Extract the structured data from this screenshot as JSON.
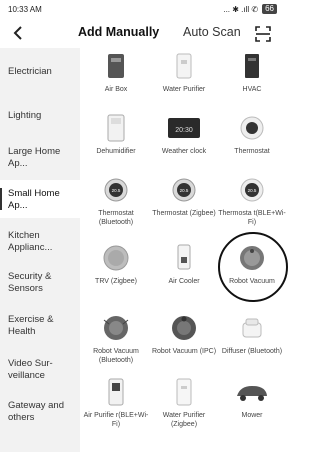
{
  "status": {
    "time": "10:33 AM",
    "icons": "... ✱ .ıll ✆",
    "battery": "66"
  },
  "header": {
    "back_glyph": "<",
    "tab_manual": "Add Manually",
    "tab_auto": "Auto Scan"
  },
  "sidebar": {
    "items": [
      {
        "label": "Electrician"
      },
      {
        "label": "Lighting"
      },
      {
        "label": "Large Home Ap..."
      },
      {
        "label": "Small Home Ap...",
        "active": true
      },
      {
        "label": "Kitchen Applianc..."
      },
      {
        "label": "Security & Sensors"
      },
      {
        "label": "Exercise & Health"
      },
      {
        "label": "Video Sur- veillance"
      },
      {
        "label": "Gateway and others"
      }
    ]
  },
  "devices": [
    {
      "label": "Air Box",
      "icon": "air-box-icon"
    },
    {
      "label": "Water Purifier",
      "icon": "water-purifier-icon"
    },
    {
      "label": "HVAC",
      "icon": "hvac-icon"
    },
    {
      "label": "Dehumidifier",
      "icon": "dehumidifier-icon"
    },
    {
      "label": "Weather clock",
      "icon": "weather-clock-icon",
      "screen": "20:30"
    },
    {
      "label": "Thermostat",
      "icon": "thermostat-icon"
    },
    {
      "label": "Thermostat (Bluetooth)",
      "icon": "thermostat-icon",
      "screen": "20.5"
    },
    {
      "label": "Thermostat (Zigbee)",
      "icon": "thermostat-icon",
      "screen": "20.5"
    },
    {
      "label": "Thermosta t(BLE+Wi-Fi)",
      "icon": "thermostat-icon",
      "screen": "20.5"
    },
    {
      "label": "TRV (Zigbee)",
      "icon": "trv-icon"
    },
    {
      "label": "Air Cooler",
      "icon": "air-cooler-icon"
    },
    {
      "label": "Robot Vacuum",
      "icon": "robot-vacuum-icon",
      "highlighted": true
    },
    {
      "label": "Robot Vacuum (Bluetooth)",
      "icon": "robot-vacuum-icon"
    },
    {
      "label": "Robot Vacuum (IPC)",
      "icon": "robot-vacuum-icon"
    },
    {
      "label": "Diffuser (Bluetooth)",
      "icon": "diffuser-icon"
    },
    {
      "label": "Air Purifie r(BLE+Wi-Fi)",
      "icon": "air-purifier-icon"
    },
    {
      "label": "Water Purifier (Zigbee)",
      "icon": "water-purifier-icon"
    },
    {
      "label": "Mower",
      "icon": "mower-icon"
    }
  ]
}
